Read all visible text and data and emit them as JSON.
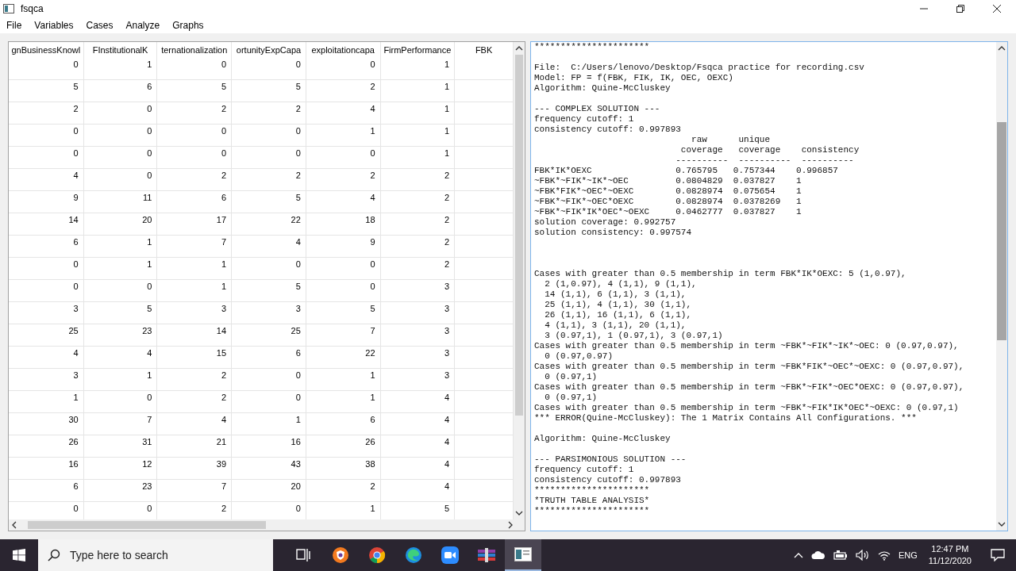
{
  "window": {
    "title": "fsqca"
  },
  "menu": [
    "File",
    "Variables",
    "Cases",
    "Analyze",
    "Graphs"
  ],
  "table": {
    "columns": [
      "gnBusinessKnowl",
      "FInstitutionalK",
      "ternationalization",
      "ortunityExpCapa",
      "exploitationcapa",
      "FirmPerformance",
      "FBK"
    ],
    "rows": [
      [
        "0",
        "1",
        "0",
        "0",
        "0",
        "1"
      ],
      [
        "5",
        "6",
        "5",
        "5",
        "2",
        "1"
      ],
      [
        "2",
        "0",
        "2",
        "2",
        "4",
        "1"
      ],
      [
        "0",
        "0",
        "0",
        "0",
        "1",
        "1"
      ],
      [
        "0",
        "0",
        "0",
        "0",
        "0",
        "1"
      ],
      [
        "4",
        "0",
        "2",
        "2",
        "2",
        "2"
      ],
      [
        "9",
        "11",
        "6",
        "5",
        "4",
        "2"
      ],
      [
        "14",
        "20",
        "17",
        "22",
        "18",
        "2"
      ],
      [
        "6",
        "1",
        "7",
        "4",
        "9",
        "2"
      ],
      [
        "0",
        "1",
        "1",
        "0",
        "0",
        "2"
      ],
      [
        "0",
        "0",
        "1",
        "5",
        "0",
        "3"
      ],
      [
        "3",
        "5",
        "3",
        "3",
        "5",
        "3"
      ],
      [
        "25",
        "23",
        "14",
        "25",
        "7",
        "3"
      ],
      [
        "4",
        "4",
        "15",
        "6",
        "22",
        "3"
      ],
      [
        "3",
        "1",
        "2",
        "0",
        "1",
        "3"
      ],
      [
        "1",
        "0",
        "2",
        "0",
        "1",
        "4"
      ],
      [
        "30",
        "7",
        "4",
        "1",
        "6",
        "4"
      ],
      [
        "26",
        "31",
        "21",
        "16",
        "26",
        "4"
      ],
      [
        "16",
        "12",
        "39",
        "43",
        "38",
        "4"
      ],
      [
        "6",
        "23",
        "7",
        "20",
        "2",
        "4"
      ],
      [
        "0",
        "0",
        "2",
        "0",
        "1",
        "5"
      ]
    ]
  },
  "output": "**********************\n\nFile:  C:/Users/lenovo/Desktop/Fsqca practice for recording.csv\nModel: FP = f(FBK, FIK, IK, OEC, OEXC)\nAlgorithm: Quine-McCluskey\n\n--- COMPLEX SOLUTION ---\nfrequency cutoff: 1\nconsistency cutoff: 0.997893\n                              raw      unique\n                            coverage   coverage    consistency\n                           ----------  ----------  ----------\nFBK*IK*OEXC                0.765795   0.757344    0.996857\n~FBK*~FIK*~IK*~OEC         0.0804829  0.037827    1\n~FBK*FIK*~OEC*~OEXC        0.0828974  0.075654    1\n~FBK*~FIK*~OEC*OEXC        0.0828974  0.0378269   1\n~FBK*~FIK*IK*OEC*~OEXC     0.0462777  0.037827    1\nsolution coverage: 0.992757\nsolution consistency: 0.997574\n\n\n\nCases with greater than 0.5 membership in term FBK*IK*OEXC: 5 (1,0.97),\n  2 (1,0.97), 4 (1,1), 9 (1,1),\n  14 (1,1), 6 (1,1), 3 (1,1),\n  25 (1,1), 4 (1,1), 30 (1,1),\n  26 (1,1), 16 (1,1), 6 (1,1),\n  4 (1,1), 3 (1,1), 20 (1,1),\n  3 (0.97,1), 1 (0.97,1), 3 (0.97,1)\nCases with greater than 0.5 membership in term ~FBK*~FIK*~IK*~OEC: 0 (0.97,0.97),\n  0 (0.97,0.97)\nCases with greater than 0.5 membership in term ~FBK*FIK*~OEC*~OEXC: 0 (0.97,0.97),\n  0 (0.97,1)\nCases with greater than 0.5 membership in term ~FBK*~FIK*~OEC*OEXC: 0 (0.97,0.97),\n  0 (0.97,1)\nCases with greater than 0.5 membership in term ~FBK*~FIK*IK*OEC*~OEXC: 0 (0.97,1)\n*** ERROR(Quine-McCluskey): The 1 Matrix Contains All Configurations. ***\n\nAlgorithm: Quine-McCluskey\n\n--- PARSIMONIOUS SOLUTION ---\nfrequency cutoff: 1\nconsistency cutoff: 0.997893\n**********************\n*TRUTH TABLE ANALYSIS*\n**********************",
  "taskbar": {
    "search": {
      "placeholder": "Type here to search"
    },
    "apps": [
      {
        "kind": "task-view",
        "selected": false
      },
      {
        "kind": "lion",
        "selected": false
      },
      {
        "kind": "chrome",
        "selected": false
      },
      {
        "kind": "edge",
        "selected": false
      },
      {
        "kind": "camera",
        "selected": false
      },
      {
        "kind": "books",
        "selected": false
      },
      {
        "kind": "window",
        "selected": true
      }
    ],
    "language": "ENG",
    "time": "12:47 PM",
    "date": "11/12/2020"
  }
}
